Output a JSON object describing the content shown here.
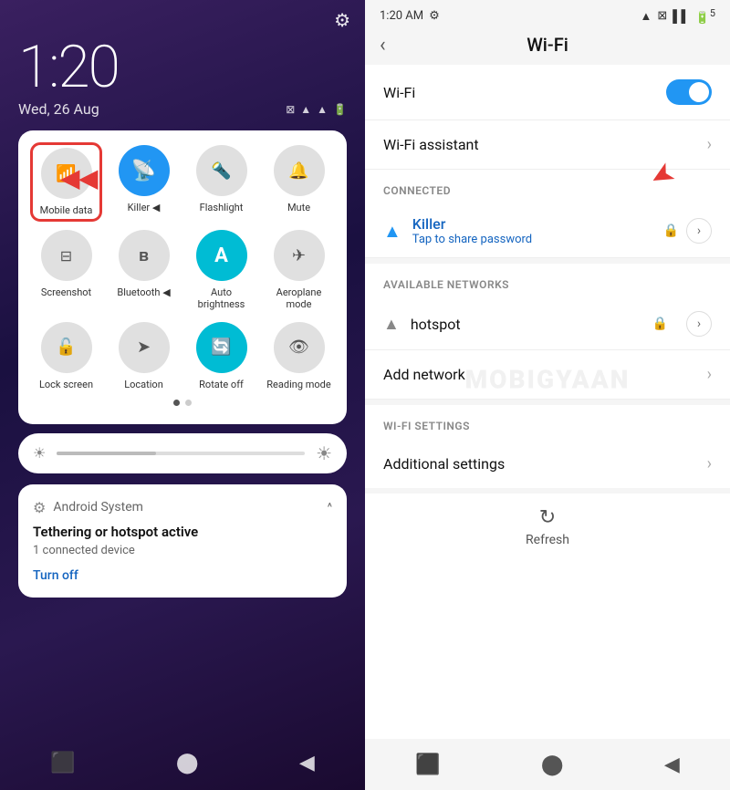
{
  "left": {
    "clock": "1:20",
    "date": "Wed, 26 Aug",
    "quick_settings": {
      "items": [
        {
          "id": "mobile-data",
          "label": "Mobile data",
          "icon": "📶",
          "active": false,
          "highlighted": true
        },
        {
          "id": "killer-wifi",
          "label": "Killer ◀",
          "icon": "📡",
          "active": true,
          "arrow": true
        },
        {
          "id": "flashlight",
          "label": "Flashlight",
          "icon": "🔦",
          "active": false
        },
        {
          "id": "mute",
          "label": "Mute",
          "icon": "🔔",
          "active": false
        },
        {
          "id": "screenshot",
          "label": "Screenshot",
          "icon": "📷",
          "active": false
        },
        {
          "id": "bluetooth",
          "label": "Bluetooth ◀",
          "icon": "Ⓑ",
          "active": false
        },
        {
          "id": "auto-brightness",
          "label": "Auto brightness",
          "icon": "A",
          "active": true
        },
        {
          "id": "aeroplane",
          "label": "Aeroplane mode",
          "icon": "✈",
          "active": false
        },
        {
          "id": "lock-screen",
          "label": "Lock screen",
          "icon": "🔓",
          "active": false
        },
        {
          "id": "location",
          "label": "Location",
          "icon": "➤",
          "active": false
        },
        {
          "id": "rotate-off",
          "label": "Rotate off",
          "icon": "🔄",
          "active": true
        },
        {
          "id": "reading-mode",
          "label": "Reading mode",
          "icon": "👁",
          "active": false
        }
      ]
    },
    "notification": {
      "app": "Android System",
      "caret": "^",
      "title": "Tethering or hotspot active",
      "sub": "1 connected device",
      "action": "Turn off"
    },
    "nav": [
      "⬛",
      "⬤",
      "◀"
    ]
  },
  "right": {
    "status": {
      "time": "1:20 AM",
      "gear": "⚙",
      "wifi": "WiFi",
      "battery": "5"
    },
    "title": "Wi-Fi",
    "back_label": "‹",
    "toggle_label": "Wi-Fi",
    "assistant_label": "Wi-Fi assistant",
    "connected_section": "CONNECTED",
    "network_name": "Killer",
    "network_sub": "Tap to share password",
    "available_section": "AVAILABLE NETWORKS",
    "hotspot_label": "hotspot",
    "add_network_label": "Add network",
    "wifi_settings_section": "WI-FI SETTINGS",
    "additional_settings_label": "Additional settings",
    "refresh_label": "Refresh",
    "nav": [
      "⬛",
      "⬤",
      "◀"
    ]
  }
}
